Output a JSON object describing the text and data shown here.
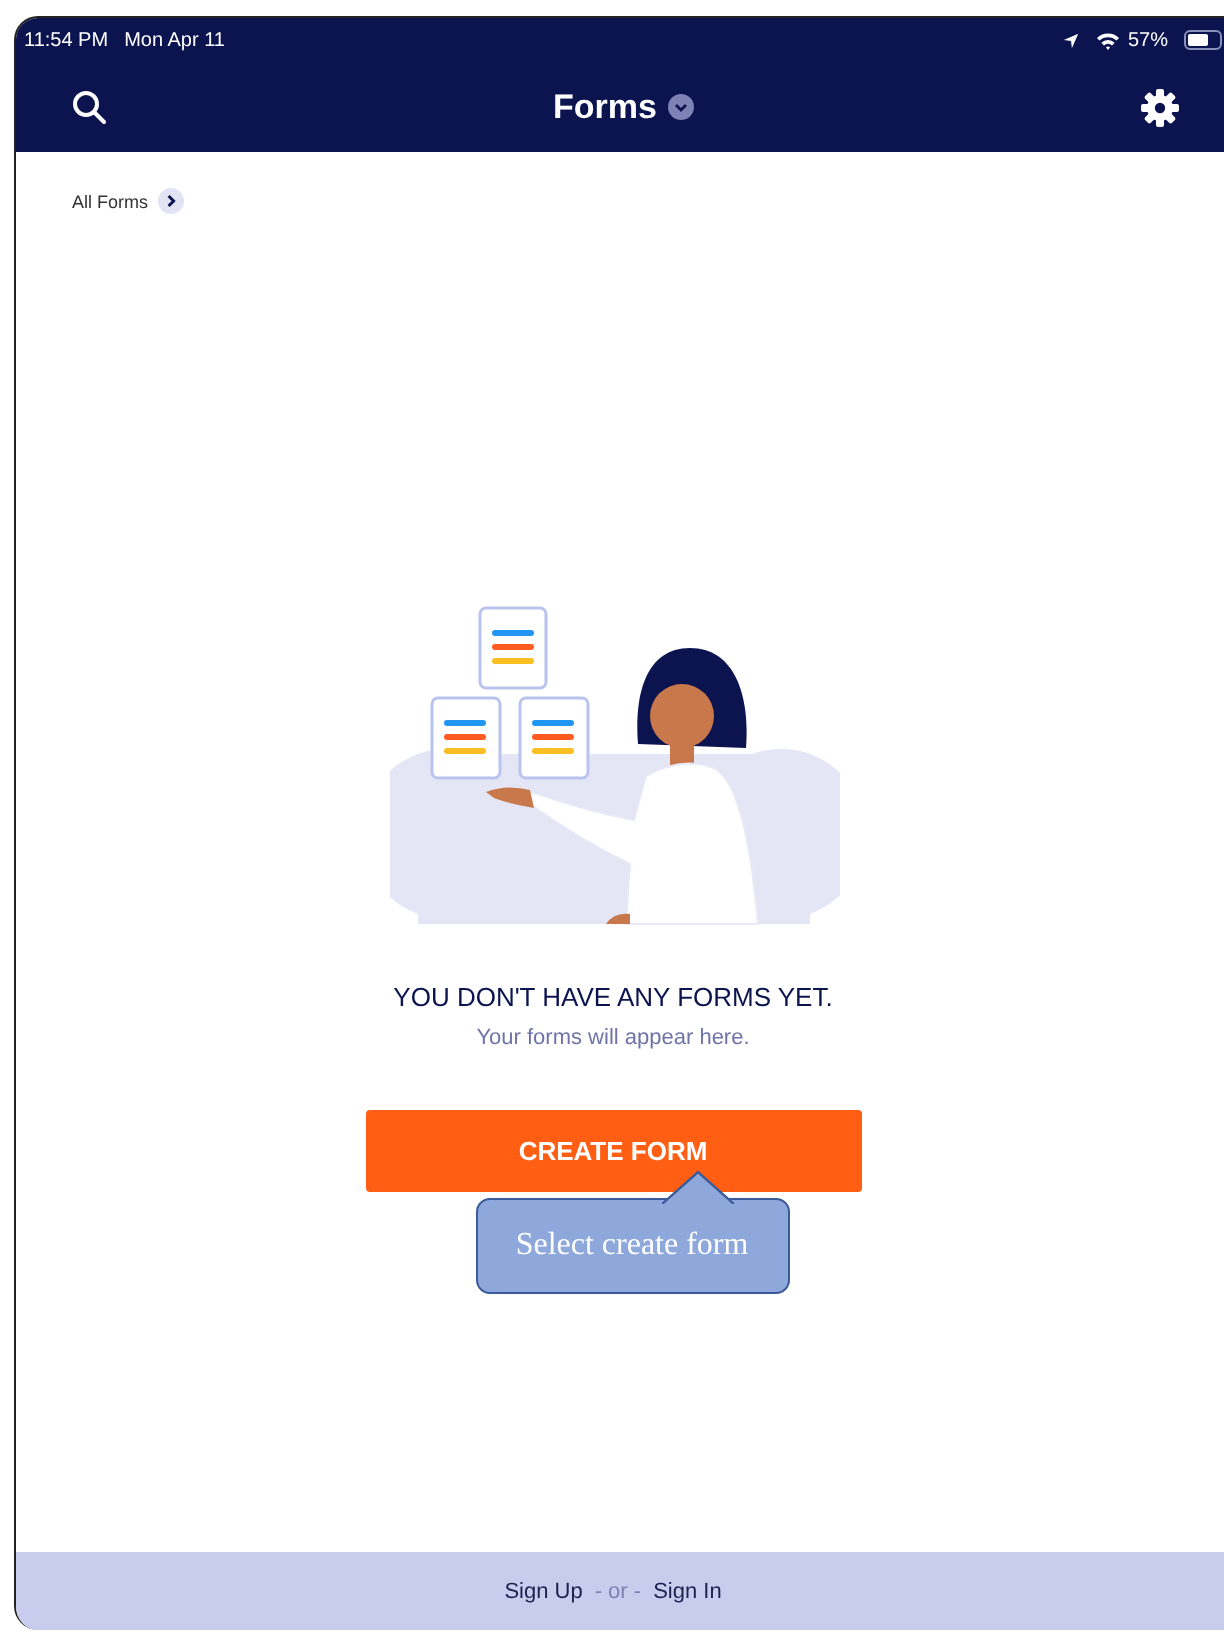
{
  "status_bar": {
    "time": "11:54 PM",
    "date": "Mon Apr 11",
    "battery": "57%"
  },
  "nav_bar": {
    "title": "Forms"
  },
  "breadcrumb": {
    "label": "All Forms"
  },
  "empty_state": {
    "title": "YOU DON'T HAVE ANY FORMS YET.",
    "subtitle": "Your forms will appear here."
  },
  "create_button": {
    "label": "CREATE FORM"
  },
  "callout": {
    "text": "Select create form"
  },
  "footer": {
    "sign_up": "Sign Up",
    "separator": "- or -",
    "sign_in": "Sign In"
  }
}
